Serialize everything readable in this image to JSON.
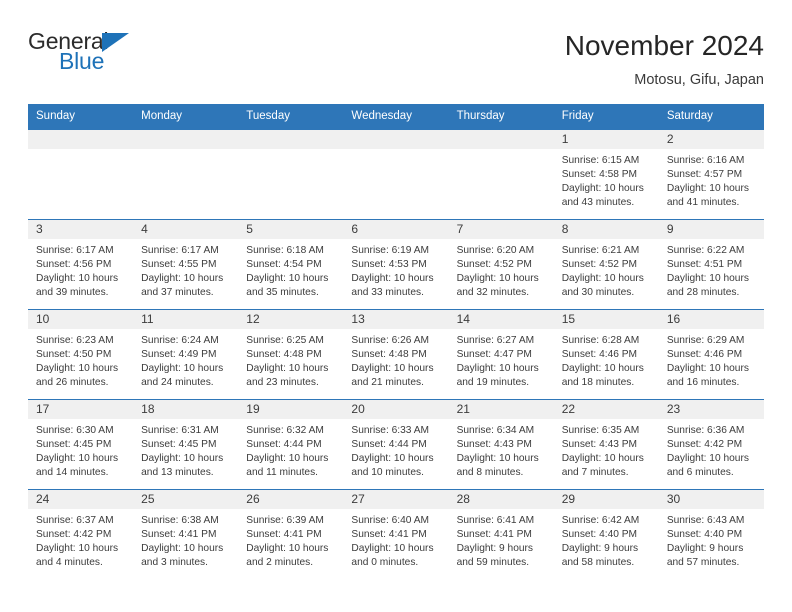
{
  "logo": {
    "part1": "General",
    "part2": "Blue",
    "triangle_color": "#1e72b8"
  },
  "header": {
    "month_title": "November 2024",
    "location": "Motosu, Gifu, Japan"
  },
  "theme": {
    "header_blue": "#2e76b8",
    "date_band_grey": "#f0f0f0",
    "text_color": "#3c3c3c"
  },
  "weekdays": [
    "Sunday",
    "Monday",
    "Tuesday",
    "Wednesday",
    "Thursday",
    "Friday",
    "Saturday"
  ],
  "weeks": [
    [
      {
        "day": "",
        "empty": true
      },
      {
        "day": "",
        "empty": true
      },
      {
        "day": "",
        "empty": true
      },
      {
        "day": "",
        "empty": true
      },
      {
        "day": "",
        "empty": true
      },
      {
        "day": "1",
        "sunrise": "Sunrise: 6:15 AM",
        "sunset": "Sunset: 4:58 PM",
        "daylight": "Daylight: 10 hours and 43 minutes."
      },
      {
        "day": "2",
        "sunrise": "Sunrise: 6:16 AM",
        "sunset": "Sunset: 4:57 PM",
        "daylight": "Daylight: 10 hours and 41 minutes."
      }
    ],
    [
      {
        "day": "3",
        "sunrise": "Sunrise: 6:17 AM",
        "sunset": "Sunset: 4:56 PM",
        "daylight": "Daylight: 10 hours and 39 minutes."
      },
      {
        "day": "4",
        "sunrise": "Sunrise: 6:17 AM",
        "sunset": "Sunset: 4:55 PM",
        "daylight": "Daylight: 10 hours and 37 minutes."
      },
      {
        "day": "5",
        "sunrise": "Sunrise: 6:18 AM",
        "sunset": "Sunset: 4:54 PM",
        "daylight": "Daylight: 10 hours and 35 minutes."
      },
      {
        "day": "6",
        "sunrise": "Sunrise: 6:19 AM",
        "sunset": "Sunset: 4:53 PM",
        "daylight": "Daylight: 10 hours and 33 minutes."
      },
      {
        "day": "7",
        "sunrise": "Sunrise: 6:20 AM",
        "sunset": "Sunset: 4:52 PM",
        "daylight": "Daylight: 10 hours and 32 minutes."
      },
      {
        "day": "8",
        "sunrise": "Sunrise: 6:21 AM",
        "sunset": "Sunset: 4:52 PM",
        "daylight": "Daylight: 10 hours and 30 minutes."
      },
      {
        "day": "9",
        "sunrise": "Sunrise: 6:22 AM",
        "sunset": "Sunset: 4:51 PM",
        "daylight": "Daylight: 10 hours and 28 minutes."
      }
    ],
    [
      {
        "day": "10",
        "sunrise": "Sunrise: 6:23 AM",
        "sunset": "Sunset: 4:50 PM",
        "daylight": "Daylight: 10 hours and 26 minutes."
      },
      {
        "day": "11",
        "sunrise": "Sunrise: 6:24 AM",
        "sunset": "Sunset: 4:49 PM",
        "daylight": "Daylight: 10 hours and 24 minutes."
      },
      {
        "day": "12",
        "sunrise": "Sunrise: 6:25 AM",
        "sunset": "Sunset: 4:48 PM",
        "daylight": "Daylight: 10 hours and 23 minutes."
      },
      {
        "day": "13",
        "sunrise": "Sunrise: 6:26 AM",
        "sunset": "Sunset: 4:48 PM",
        "daylight": "Daylight: 10 hours and 21 minutes."
      },
      {
        "day": "14",
        "sunrise": "Sunrise: 6:27 AM",
        "sunset": "Sunset: 4:47 PM",
        "daylight": "Daylight: 10 hours and 19 minutes."
      },
      {
        "day": "15",
        "sunrise": "Sunrise: 6:28 AM",
        "sunset": "Sunset: 4:46 PM",
        "daylight": "Daylight: 10 hours and 18 minutes."
      },
      {
        "day": "16",
        "sunrise": "Sunrise: 6:29 AM",
        "sunset": "Sunset: 4:46 PM",
        "daylight": "Daylight: 10 hours and 16 minutes."
      }
    ],
    [
      {
        "day": "17",
        "sunrise": "Sunrise: 6:30 AM",
        "sunset": "Sunset: 4:45 PM",
        "daylight": "Daylight: 10 hours and 14 minutes."
      },
      {
        "day": "18",
        "sunrise": "Sunrise: 6:31 AM",
        "sunset": "Sunset: 4:45 PM",
        "daylight": "Daylight: 10 hours and 13 minutes."
      },
      {
        "day": "19",
        "sunrise": "Sunrise: 6:32 AM",
        "sunset": "Sunset: 4:44 PM",
        "daylight": "Daylight: 10 hours and 11 minutes."
      },
      {
        "day": "20",
        "sunrise": "Sunrise: 6:33 AM",
        "sunset": "Sunset: 4:44 PM",
        "daylight": "Daylight: 10 hours and 10 minutes."
      },
      {
        "day": "21",
        "sunrise": "Sunrise: 6:34 AM",
        "sunset": "Sunset: 4:43 PM",
        "daylight": "Daylight: 10 hours and 8 minutes."
      },
      {
        "day": "22",
        "sunrise": "Sunrise: 6:35 AM",
        "sunset": "Sunset: 4:43 PM",
        "daylight": "Daylight: 10 hours and 7 minutes."
      },
      {
        "day": "23",
        "sunrise": "Sunrise: 6:36 AM",
        "sunset": "Sunset: 4:42 PM",
        "daylight": "Daylight: 10 hours and 6 minutes."
      }
    ],
    [
      {
        "day": "24",
        "sunrise": "Sunrise: 6:37 AM",
        "sunset": "Sunset: 4:42 PM",
        "daylight": "Daylight: 10 hours and 4 minutes."
      },
      {
        "day": "25",
        "sunrise": "Sunrise: 6:38 AM",
        "sunset": "Sunset: 4:41 PM",
        "daylight": "Daylight: 10 hours and 3 minutes."
      },
      {
        "day": "26",
        "sunrise": "Sunrise: 6:39 AM",
        "sunset": "Sunset: 4:41 PM",
        "daylight": "Daylight: 10 hours and 2 minutes."
      },
      {
        "day": "27",
        "sunrise": "Sunrise: 6:40 AM",
        "sunset": "Sunset: 4:41 PM",
        "daylight": "Daylight: 10 hours and 0 minutes."
      },
      {
        "day": "28",
        "sunrise": "Sunrise: 6:41 AM",
        "sunset": "Sunset: 4:41 PM",
        "daylight": "Daylight: 9 hours and 59 minutes."
      },
      {
        "day": "29",
        "sunrise": "Sunrise: 6:42 AM",
        "sunset": "Sunset: 4:40 PM",
        "daylight": "Daylight: 9 hours and 58 minutes."
      },
      {
        "day": "30",
        "sunrise": "Sunrise: 6:43 AM",
        "sunset": "Sunset: 4:40 PM",
        "daylight": "Daylight: 9 hours and 57 minutes."
      }
    ]
  ]
}
